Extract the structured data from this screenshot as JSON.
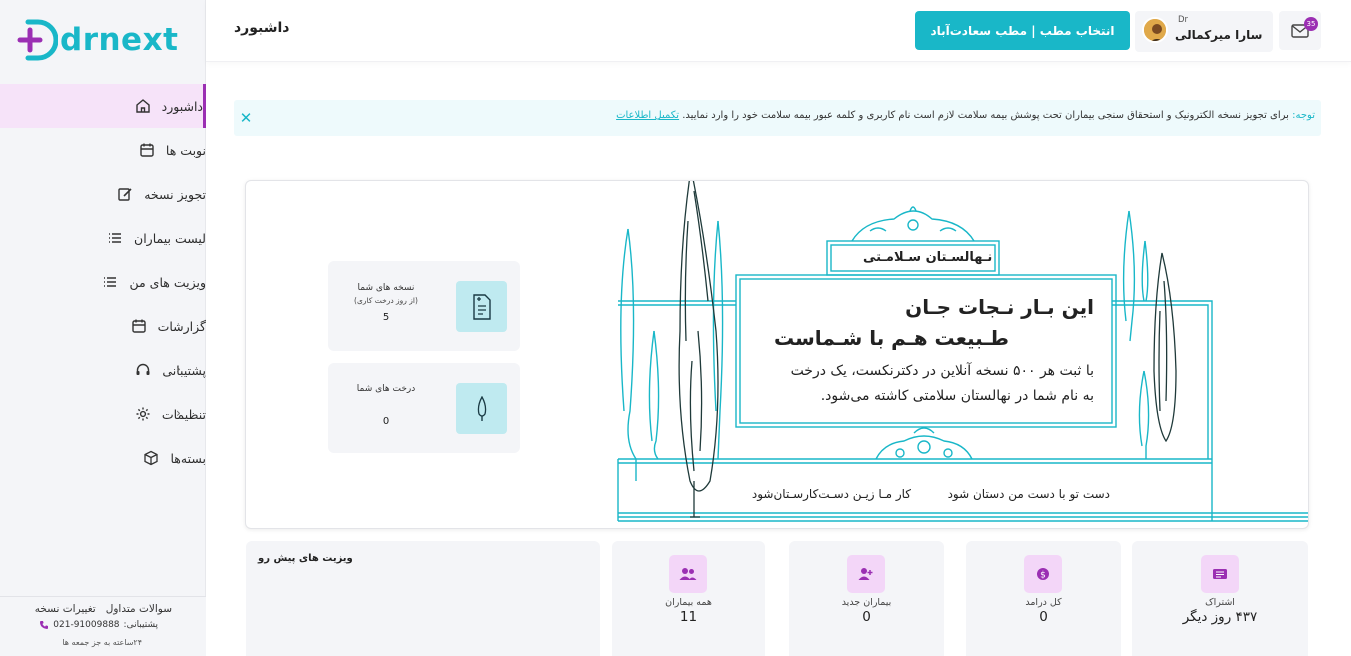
{
  "app": {
    "logo_text": "drnext"
  },
  "sidebar": {
    "items": [
      {
        "label": "داشبورد",
        "icon": "home-icon",
        "active": true
      },
      {
        "label": "نوبت ها",
        "icon": "calendar-icon"
      },
      {
        "label": "تجویز نسخه",
        "icon": "edit-icon"
      },
      {
        "label": "لیست بیماران",
        "icon": "list-icon"
      },
      {
        "label": "ویزیت های من",
        "icon": "list-icon"
      },
      {
        "label": "گزارشات",
        "icon": "calendar-icon"
      },
      {
        "label": "پشتیبانی",
        "icon": "headset-icon"
      },
      {
        "label": "تنظیمات",
        "icon": "gear-icon"
      },
      {
        "label": "بسته‌ها",
        "icon": "box-icon"
      }
    ],
    "footer": {
      "faq": "سوالات متداول",
      "version_changes": "تغییرات نسخه",
      "support_label": ":پشتیبانی",
      "support_phone": "021-91009888",
      "hours": "۲۴ساعته به جز جمعه ها"
    }
  },
  "header": {
    "page_title": "داشبورد",
    "clinic_button": "انتخاب مطب | مطب سعادت‌آباد",
    "user_title": "Dr",
    "user_name": "سارا میرکمالی",
    "mail_badge": "35"
  },
  "notice": {
    "prefix": "توجه:",
    "text": " برای تجویز نسخه الکترونیک و استحقاق سنجی بیماران تحت پوشش بیمه سلامت لازم است نام کاربری و کلمه عبور بیمه سلامت خود را وارد نمایید. ",
    "link": "تکمیل اطلاعات"
  },
  "banner": {
    "stats": [
      {
        "title": "نسخه های شما",
        "subtitle": "(از روز درخت کاری)",
        "value": "5",
        "icon": "prescription-icon"
      },
      {
        "title": "درخت های شما",
        "subtitle": "",
        "value": "0",
        "icon": "tree-icon"
      }
    ],
    "sign": "نـهالسـتان سـلامـتی",
    "headline_1": "این بـار نـجات جـان",
    "headline_2": "طـبیعت هـم با شـماست",
    "body_1": "با ثبت هر ۵۰۰ نسخه آنلاین در دکترنکست، یک درخت",
    "body_2": "به نام شما در نهالستان سلامتی کاشته می‌شود.",
    "caption_1": "دست تو با دست من دستان شود",
    "caption_2": "کار مـا زیـن دسـت‌کارسـتان‌شود"
  },
  "cards": [
    {
      "label": "اشتراک",
      "value": "۴۳۷ روز دیگر",
      "icon": "subscription-icon"
    },
    {
      "label": "کل درامد",
      "value": "0",
      "icon": "money-icon"
    },
    {
      "label": "بیماران جدید",
      "value": "0",
      "icon": "user-add-icon"
    },
    {
      "label": "همه بیماران",
      "value": "11",
      "icon": "users-icon"
    }
  ],
  "visits": {
    "title": "ویزیت های پیش رو"
  },
  "colors": {
    "accent": "#19b7c8",
    "brand_purple": "#9b2fb3",
    "active_bg": "#f6e3f9"
  }
}
